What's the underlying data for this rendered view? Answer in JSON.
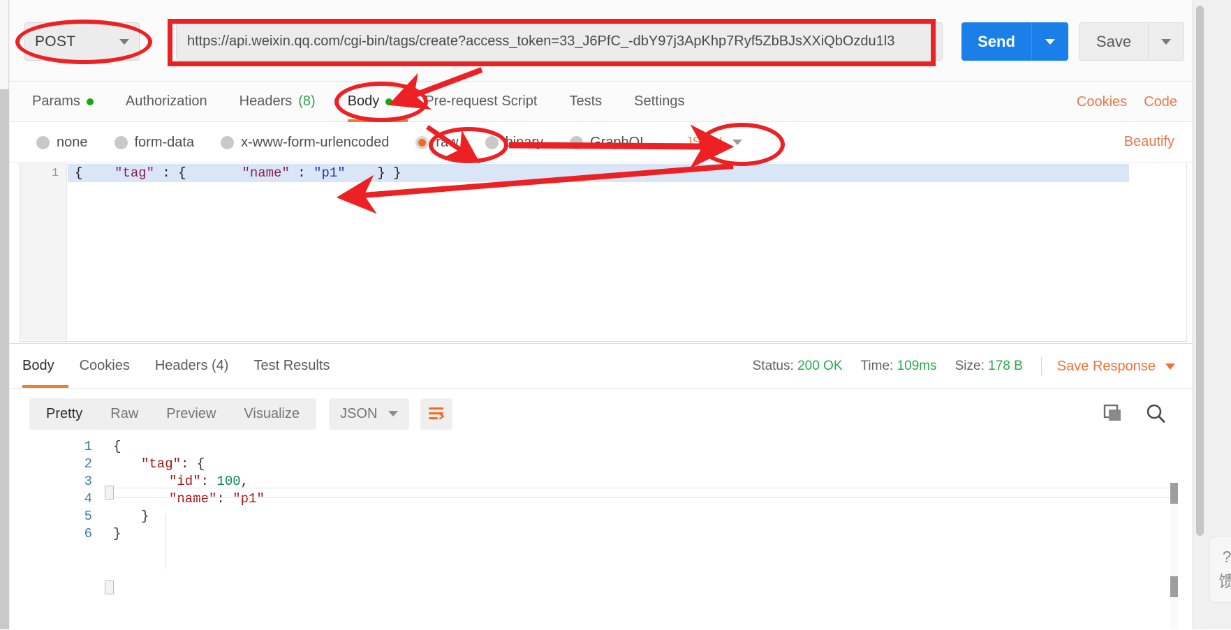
{
  "request": {
    "method": "POST",
    "url": "https://api.weixin.qq.com/cgi-bin/tags/create?access_token=33_J6PfC_-dbY97j3ApKhp7Ryf5ZbBJsXXiQbOzdu1l3",
    "send_label": "Send",
    "save_label": "Save",
    "tabs": [
      {
        "label": "Params",
        "badge": "dot",
        "count": ""
      },
      {
        "label": "Authorization",
        "badge": "",
        "count": ""
      },
      {
        "label": "Headers",
        "badge": "",
        "count": "(8)"
      },
      {
        "label": "Body",
        "badge": "dot",
        "count": ""
      },
      {
        "label": "Pre-request Script",
        "badge": "",
        "count": ""
      },
      {
        "label": "Tests",
        "badge": "",
        "count": ""
      },
      {
        "label": "Settings",
        "badge": "",
        "count": ""
      }
    ],
    "active_tab": "Body",
    "links": {
      "cookies": "Cookies",
      "code": "Code"
    },
    "body_types": [
      {
        "label": "none",
        "selected": false
      },
      {
        "label": "form-data",
        "selected": false
      },
      {
        "label": "x-www-form-urlencoded",
        "selected": false
      },
      {
        "label": "raw",
        "selected": true
      },
      {
        "label": "binary",
        "selected": false
      },
      {
        "label": "GraphQL",
        "selected": false
      }
    ],
    "raw_format": "JSON",
    "beautify_label": "Beautify",
    "editor": {
      "line_number": "1",
      "tokens": [
        {
          "t": "{    ",
          "c": "punc"
        },
        {
          "t": "\"tag\"",
          "c": "key"
        },
        {
          "t": " : {       ",
          "c": "punc"
        },
        {
          "t": "\"name\"",
          "c": "key"
        },
        {
          "t": " : ",
          "c": "punc"
        },
        {
          "t": "\"p1\"",
          "c": "str"
        },
        {
          "t": "    } }",
          "c": "punc"
        }
      ]
    }
  },
  "response": {
    "tabs": [
      "Body",
      "Cookies",
      "Headers (4)",
      "Test Results"
    ],
    "active_tab": "Body",
    "status_label": "Status:",
    "status_value": "200 OK",
    "time_label": "Time:",
    "time_value": "109ms",
    "size_label": "Size:",
    "size_value": "178 B",
    "save_response_label": "Save Response",
    "view_modes": [
      "Pretty",
      "Raw",
      "Preview",
      "Visualize"
    ],
    "active_view": "Pretty",
    "format": "JSON",
    "icons": {
      "wrap": "word-wrap-icon",
      "copy": "copy-icon",
      "search": "search-icon"
    },
    "body_lines": [
      {
        "n": "1",
        "indent": 0,
        "tokens": [
          {
            "t": "{",
            "c": "p"
          }
        ]
      },
      {
        "n": "2",
        "indent": 1,
        "tokens": [
          {
            "t": "\"tag\"",
            "c": "k"
          },
          {
            "t": ": {",
            "c": "p"
          }
        ]
      },
      {
        "n": "3",
        "indent": 2,
        "tokens": [
          {
            "t": "\"id\"",
            "c": "k"
          },
          {
            "t": ": ",
            "c": "p"
          },
          {
            "t": "100",
            "c": "n"
          },
          {
            "t": ",",
            "c": "p"
          }
        ]
      },
      {
        "n": "4",
        "indent": 2,
        "tokens": [
          {
            "t": "\"name\"",
            "c": "k"
          },
          {
            "t": ": ",
            "c": "p"
          },
          {
            "t": "\"p1\"",
            "c": "s"
          }
        ]
      },
      {
        "n": "5",
        "indent": 1,
        "tokens": [
          {
            "t": "}",
            "c": "p"
          }
        ]
      },
      {
        "n": "6",
        "indent": 0,
        "tokens": [
          {
            "t": "}",
            "c": "p"
          }
        ]
      }
    ]
  },
  "feedback_widget": {
    "icon": "question-mark",
    "text": "馈"
  },
  "colors": {
    "annotation_red": "#ed2024",
    "send_blue": "#1a7fe8",
    "accent_orange": "#e8802e",
    "link_orange": "#e8784a",
    "status_green": "#2aa84a",
    "raw_selected": "#f26b21"
  }
}
